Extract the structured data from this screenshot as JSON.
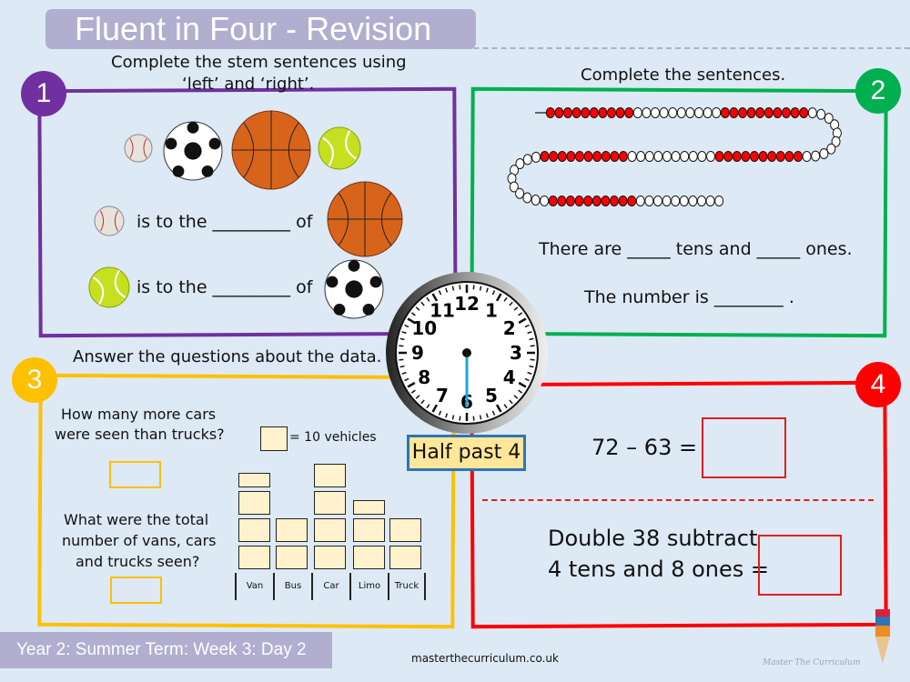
{
  "title": "Fluent in Four - Revision",
  "footer": {
    "term": "Year 2: Summer Term: Week 3: Day 2",
    "website": "masterthecurriculum.co.uk",
    "logo_text": "Master The Curriculum"
  },
  "colors": {
    "q1": "#7030a0",
    "q2": "#00b050",
    "q3": "#ffc000",
    "q4": "#ff0000",
    "title_bar": "#b1aecf"
  },
  "q1": {
    "number": "1",
    "instruction_line1": "Complete the stem sentences using",
    "instruction_line2": "‘left’ and ‘right’.",
    "balls_row": [
      "baseball",
      "football",
      "basketball",
      "tennis-ball"
    ],
    "sentences": [
      {
        "subject": "baseball",
        "text": "is to the _________ of",
        "object": "basketball"
      },
      {
        "subject": "tennis-ball",
        "text": "is to the _________ of",
        "object": "football"
      }
    ]
  },
  "q2": {
    "number": "2",
    "instruction": "Complete the sentences.",
    "bead_string": {
      "total_beads": 100,
      "group_size": 10
    },
    "sentence1": "There are _____ tens and _____ ones.",
    "sentence2": "The number is ________ ."
  },
  "clock": {
    "label": "Half past 4",
    "numbers": [
      "12",
      "1",
      "2",
      "3",
      "4",
      "5",
      "6",
      "7",
      "8",
      "9",
      "10",
      "11"
    ],
    "minute_hand_points_to": 6
  },
  "q3": {
    "number": "3",
    "instruction": "Answer the questions about the data.",
    "question1_line1": "How many more cars",
    "question1_line2": "were seen than trucks?",
    "question2_line1": "What were the total",
    "question2_line2": "number of vans, cars",
    "question2_line3": "and trucks seen?",
    "key": "= 10 vehicles",
    "chart_data": {
      "type": "pictogram",
      "unit": 10,
      "categories": [
        "Van",
        "Bus",
        "Car",
        "Limo",
        "Truck"
      ],
      "values": [
        35,
        20,
        40,
        25,
        20
      ]
    }
  },
  "q4": {
    "number": "4",
    "calc1": "72 – 63 =",
    "calc2_line1": "Double 38 subtract",
    "calc2_line2": "4 tens and 8 ones ="
  }
}
